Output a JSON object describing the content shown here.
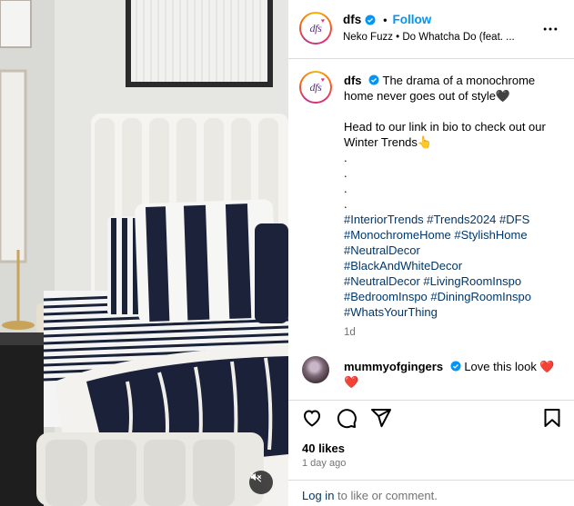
{
  "account": {
    "username": "dfs",
    "avatar_text": "dfs",
    "follow_label": "Follow",
    "separator": "•",
    "audio": "Neko Fuzz • Do Whatcha Do (feat. ..."
  },
  "caption": {
    "username": "dfs",
    "line1": "The drama of a monochrome home never goes out of style🖤",
    "line2": "Head to our link in bio to check out our Winter Trends👆",
    "dots": [
      ".",
      ".",
      ".",
      "."
    ],
    "hashtags": [
      "#InteriorTrends #Trends2024 #DFS",
      "#MonochromeHome #StylishHome",
      "#NeutralDecor",
      "#BlackAndWhiteDecor",
      "#NeutralDecor #LivingRoomInspo",
      "#BedroomInspo #DiningRoomInspo",
      "#WhatsYourThing"
    ],
    "age": "1d"
  },
  "comment": {
    "username": "mummyofgingers",
    "text": "Love this look ❤️",
    "emoji_line": "❤️"
  },
  "post_stats": {
    "likes": "40 likes",
    "time_ago": "1 day ago"
  },
  "login_prompt": {
    "link": "Log in",
    "rest": " to like or comment."
  },
  "icons": {
    "verified": "verified-badge-icon",
    "more": "more-options-icon",
    "like": "heart-icon",
    "comment": "comment-icon",
    "share": "share-icon",
    "save": "bookmark-icon",
    "mute": "muted-speaker-icon"
  },
  "colors": {
    "accent": "#0095f6",
    "link": "#00376b",
    "secondary_text": "#737373",
    "divider": "#dbdbdb",
    "heart": "#e0245e"
  }
}
